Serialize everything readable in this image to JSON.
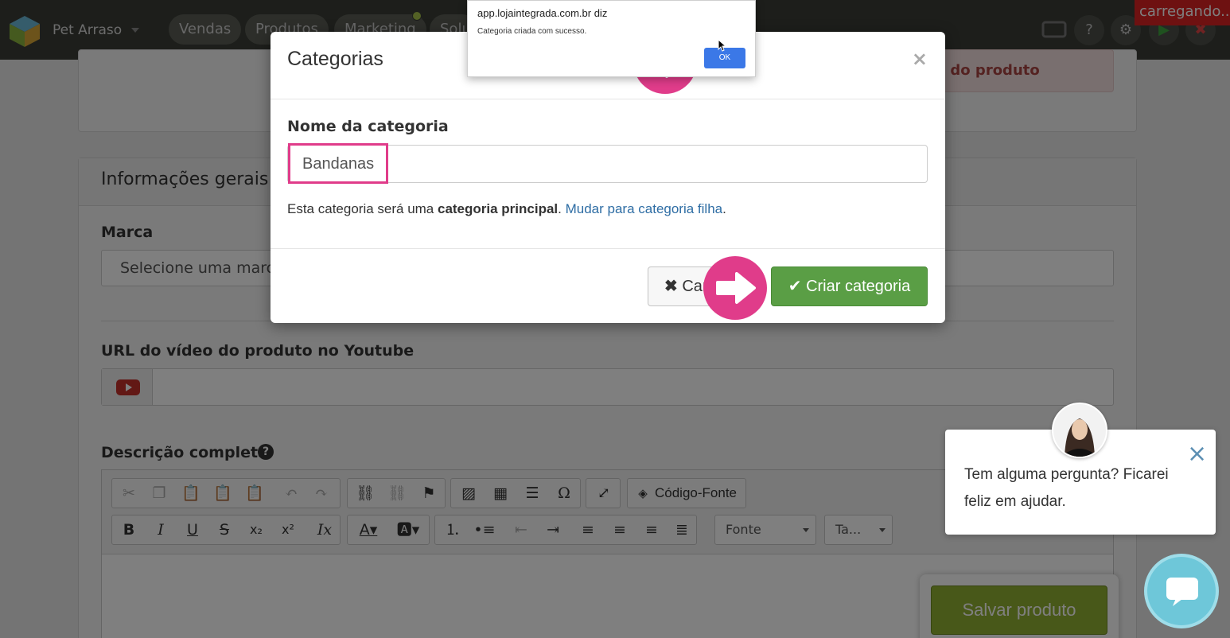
{
  "topbar": {
    "store_name": "Pet Arraso",
    "nav": [
      "Vendas",
      "Produtos",
      "Marketing",
      "Solu"
    ],
    "loading_badge": "carregando..."
  },
  "page": {
    "alert_text": "a do produto",
    "section_title": "Informações gerais",
    "brand_label": "Marca",
    "brand_placeholder": "Selecione uma marca",
    "video_label": "URL do vídeo do produto no Youtube",
    "description_label": "Descrição completa",
    "editor": {
      "source_button": "Código-Fonte",
      "font_combo": "Fonte",
      "size_combo": "Ta..."
    },
    "save_button": "Salvar produto"
  },
  "modal": {
    "title": "Categorias",
    "close": "×",
    "field_label": "Nome da categoria",
    "field_value": "Bandanas",
    "help_prefix": "Esta categoria será uma ",
    "help_bold": "categoria principal",
    "help_mid": ". ",
    "help_link": "Mudar para categoria filha",
    "help_suffix": ".",
    "cancel_button": "Cancelar",
    "create_button": "Criar categoria"
  },
  "browser_alert": {
    "origin": "app.lojaintegrada.com.br diz",
    "message": "Categoria criada com sucesso.",
    "ok": "OK"
  },
  "chat": {
    "message": "Tem alguma pergunta? Ficarei feliz em ajudar."
  },
  "colors": {
    "accent_pink": "#e03c8a",
    "create_green": "#5a9e45",
    "save_green": "#90b033",
    "alert_blue": "#3b78e7",
    "chat_teal": "#6ec7d9"
  }
}
